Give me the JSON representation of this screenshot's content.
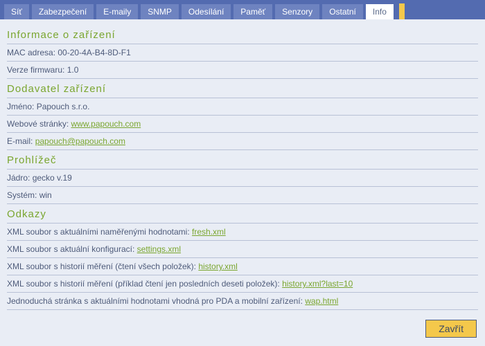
{
  "tabs": {
    "items": [
      {
        "label": "Síť",
        "active": false
      },
      {
        "label": "Zabezpečení",
        "active": false
      },
      {
        "label": "E-maily",
        "active": false
      },
      {
        "label": "SNMP",
        "active": false
      },
      {
        "label": "Odesílání",
        "active": false
      },
      {
        "label": "Paměť",
        "active": false
      },
      {
        "label": "Senzory",
        "active": false
      },
      {
        "label": "Ostatní",
        "active": false
      },
      {
        "label": "Info",
        "active": true
      }
    ]
  },
  "sections": {
    "device_info": {
      "title": "Informace o zařízení",
      "mac_label": "MAC adresa:",
      "mac_value": "00-20-4A-B4-8D-F1",
      "fw_label": "Verze firmwaru:",
      "fw_value": "1.0"
    },
    "vendor": {
      "title": "Dodavatel zařízení",
      "name_label": "Jméno:",
      "name_value": "Papouch s.r.o.",
      "web_label": "Webové stránky:",
      "web_link": "www.papouch.com",
      "email_label": "E-mail:",
      "email_link": "papouch@papouch.com"
    },
    "browser": {
      "title": "Prohlížeč",
      "engine_label": "Jádro:",
      "engine_value": "gecko v.19",
      "system_label": "Systém:",
      "system_value": "win"
    },
    "links": {
      "title": "Odkazy",
      "xml_current_label": "XML soubor s aktuálními naměřenými hodnotami:",
      "xml_current_link": "fresh.xml",
      "xml_config_label": "XML soubor s aktuální konfigurací:",
      "xml_config_link": "settings.xml",
      "xml_hist_all_label": "XML soubor s historií měření (čtení všech položek):",
      "xml_hist_all_link": "history.xml",
      "xml_hist_last_label": "XML soubor s historií měření (příklad čtení jen posledních deseti položek):",
      "xml_hist_last_link": "history.xml?last=10",
      "wap_label": "Jednoduchá stránka s aktuálními hodnotami vhodná pro PDA a mobilní zařízení:",
      "wap_link": "wap.html"
    }
  },
  "footer": {
    "close_label": "Zavřít"
  }
}
